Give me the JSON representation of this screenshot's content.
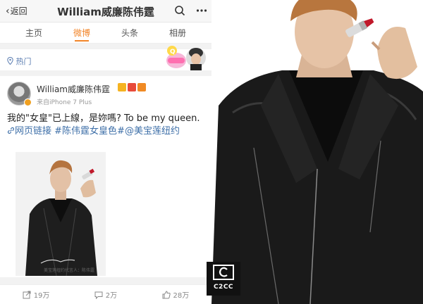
{
  "topbar": {
    "back_label": "返回",
    "title": "William威廉陈伟霆"
  },
  "tabs": [
    {
      "label": "主页"
    },
    {
      "label": "微博",
      "active": true
    },
    {
      "label": "头条"
    },
    {
      "label": "相册"
    }
  ],
  "hot": {
    "label": "热门"
  },
  "post": {
    "username": "William威廉陈伟霆",
    "source": "来自iPhone 7 Plus",
    "text_plain": "我的\"女皇\"已上線，是妳嗎? To be my queen.",
    "link": "网页链接",
    "hashtag": "#陈伟霆女皇色#",
    "mention": "@美宝莲纽约",
    "image_caption": "美宝莲纽约代言人：陈伟霆"
  },
  "actions": {
    "repost": "19万",
    "comment": "2万",
    "like": "28万"
  },
  "watermark": "C2CC",
  "colors": {
    "accent_orange": "#f28529",
    "link_blue": "#3e6fa8",
    "jacket_black": "#1a1a1a",
    "lipstick_red": "#c0182a"
  }
}
